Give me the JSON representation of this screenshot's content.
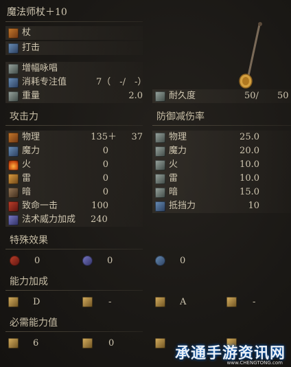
{
  "item": {
    "name": "魔法师杖＋10",
    "weapon_type": "杖",
    "attack_type": "打击",
    "skill": "增幅咏唱",
    "fp_cost_label": "消耗专注值",
    "fp_cost_value": "7（　-/　-）",
    "weight_label": "重量",
    "weight_value": "2.0",
    "durability_label": "耐久度",
    "durability_value": "50/",
    "durability_max": "50"
  },
  "attack": {
    "header": "攻击力",
    "rows": [
      {
        "label": "物理",
        "value": "135＋",
        "bonus": "37"
      },
      {
        "label": "魔力",
        "value": "0"
      },
      {
        "label": "火",
        "value": "0"
      },
      {
        "label": "雷",
        "value": "0"
      },
      {
        "label": "暗",
        "value": "0"
      },
      {
        "label": "致命一击",
        "value": "100"
      },
      {
        "label": "法术威力加成",
        "value": "240"
      }
    ]
  },
  "defense": {
    "header": "防御减伤率",
    "rows": [
      {
        "label": "物理",
        "value": "25.0"
      },
      {
        "label": "魔力",
        "value": "20.0"
      },
      {
        "label": "火",
        "value": "10.0"
      },
      {
        "label": "雷",
        "value": "10.0"
      },
      {
        "label": "暗",
        "value": "15.0"
      },
      {
        "label": "抵挡力",
        "value": "10"
      }
    ]
  },
  "effects": {
    "header": "特殊效果",
    "values": [
      "0",
      "0",
      "0"
    ]
  },
  "scaling": {
    "header": "能力加成",
    "values": [
      "D",
      "-",
      "A",
      "-"
    ]
  },
  "requirements": {
    "header": "必需能力值",
    "values": [
      "6",
      "0"
    ]
  },
  "watermark": {
    "text": "承通手游资讯网",
    "sub": "www.CHENGTONG.com"
  },
  "colors": {
    "background": "#1c1a17",
    "text": "#cfc6b0"
  }
}
